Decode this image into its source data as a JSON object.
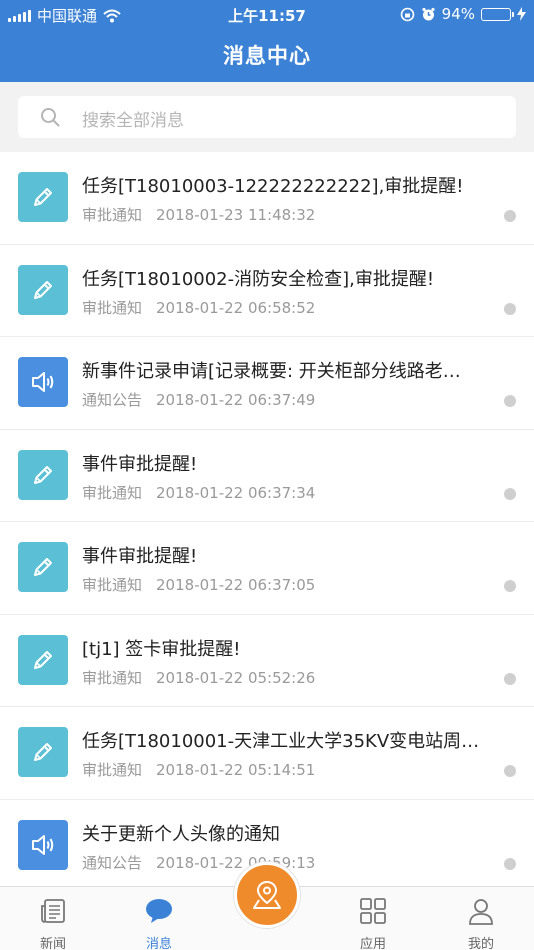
{
  "status_bar": {
    "carrier": "中国联通",
    "time": "上午11:57",
    "battery": "94%",
    "battery_level": 0.94
  },
  "header": {
    "title": "消息中心"
  },
  "search": {
    "placeholder": "搜索全部消息"
  },
  "messages": [
    {
      "title": "任务[T18010003-122222222222],审批提醒!",
      "category": "审批通知",
      "time": "2018-01-23 11:48:32",
      "icon": "pencil-icon"
    },
    {
      "title": "任务[T18010002-消防安全检查],审批提醒!",
      "category": "审批通知",
      "time": "2018-01-22 06:58:52",
      "icon": "pencil-icon"
    },
    {
      "title": "新事件记录申请[记录概要: 开关柜部分线路老…",
      "category": "通知公告",
      "time": "2018-01-22 06:37:49",
      "icon": "speaker-icon"
    },
    {
      "title": "事件审批提醒!",
      "category": "审批通知",
      "time": "2018-01-22 06:37:34",
      "icon": "pencil-icon"
    },
    {
      "title": "事件审批提醒!",
      "category": "审批通知",
      "time": "2018-01-22 06:37:05",
      "icon": "pencil-icon"
    },
    {
      "title": "[tj1] 签卡审批提醒!",
      "category": "审批通知",
      "time": "2018-01-22 05:52:26",
      "icon": "pencil-icon"
    },
    {
      "title": "任务[T18010001-天津工业大学35KV变电站周…",
      "category": "审批通知",
      "time": "2018-01-22 05:14:51",
      "icon": "pencil-icon"
    },
    {
      "title": "关于更新个人头像的通知",
      "category": "通知公告",
      "time": "2018-01-22 00:59:13",
      "icon": "speaker-icon"
    }
  ],
  "tabs": [
    {
      "label": "新闻",
      "icon": "news-icon"
    },
    {
      "label": "消息",
      "icon": "chat-bubble-icon",
      "active": true
    },
    {
      "label": "",
      "icon": "map-location-icon"
    },
    {
      "label": "应用",
      "icon": "grid-icon"
    },
    {
      "label": "我的",
      "icon": "person-icon"
    }
  ],
  "colors": {
    "primary": "#3b82d6",
    "approve": "#5bbfd6",
    "notice": "#4a8fe0",
    "fab": "#f08b2c"
  }
}
